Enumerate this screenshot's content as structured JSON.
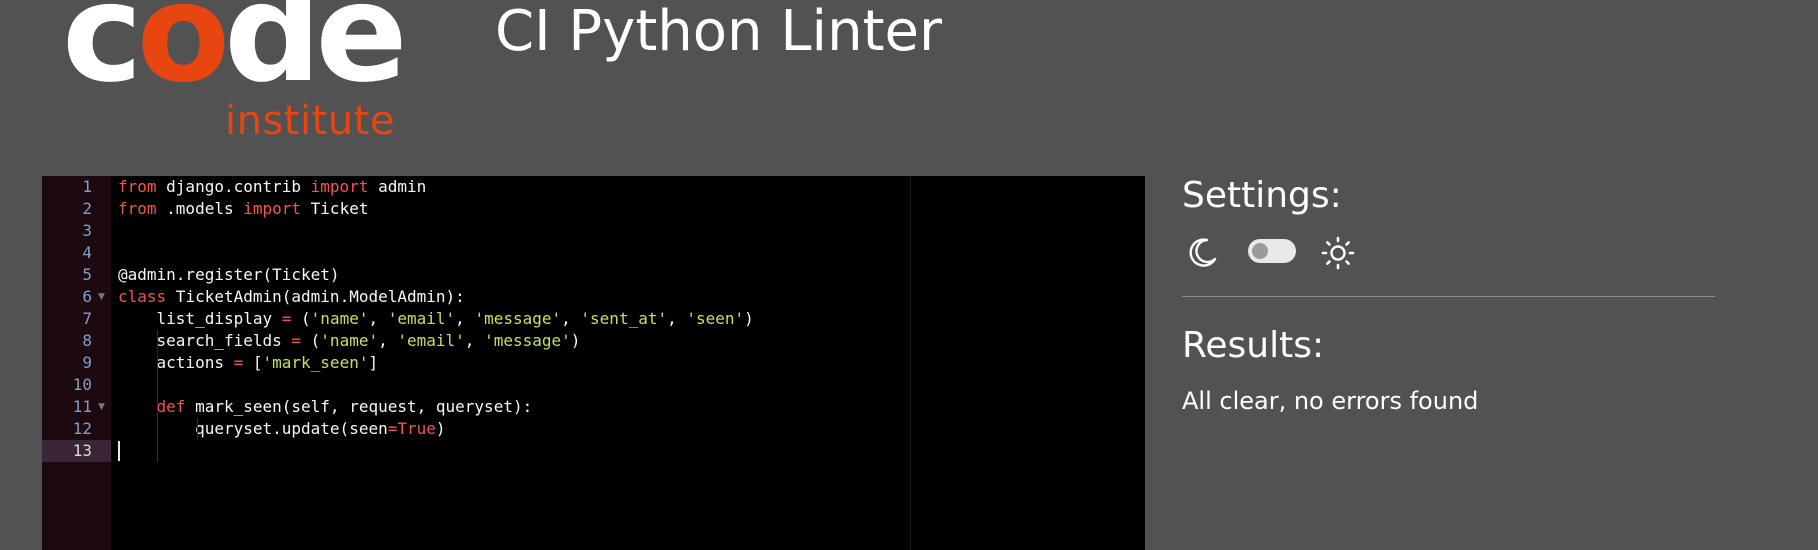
{
  "logo": {
    "word": "code",
    "word_parts": [
      "c",
      "o",
      "de"
    ],
    "subword": "institute"
  },
  "app_title": "CI Python Linter",
  "colors": {
    "background": "#525252",
    "brand_orange": "#e84610",
    "keyword": "#f9514c",
    "string": "#c6e05a",
    "editor_bg": "#000000"
  },
  "editor": {
    "active_line": 13,
    "line_numbers": [
      "1",
      "2",
      "3",
      "4",
      "5",
      "6",
      "7",
      "8",
      "9",
      "10",
      "11",
      "12",
      "13"
    ],
    "fold_markers": [
      "▼",
      "▼"
    ],
    "lines": [
      [
        {
          "t": "from",
          "c": "kw"
        },
        {
          "t": " django.contrib ",
          "c": ""
        },
        {
          "t": "import",
          "c": "kw"
        },
        {
          "t": " admin",
          "c": ""
        }
      ],
      [
        {
          "t": "from",
          "c": "kw"
        },
        {
          "t": " .models ",
          "c": ""
        },
        {
          "t": "import",
          "c": "kw"
        },
        {
          "t": " Ticket",
          "c": ""
        }
      ],
      [],
      [],
      [
        {
          "t": "@admin.register(Ticket)",
          "c": ""
        }
      ],
      [
        {
          "t": "class",
          "c": "kw"
        },
        {
          "t": " TicketAdmin(admin.ModelAdmin):",
          "c": ""
        }
      ],
      [
        {
          "t": "    list_display ",
          "c": ""
        },
        {
          "t": "=",
          "c": "op"
        },
        {
          "t": " (",
          "c": ""
        },
        {
          "t": "'name'",
          "c": "str"
        },
        {
          "t": ", ",
          "c": ""
        },
        {
          "t": "'email'",
          "c": "str"
        },
        {
          "t": ", ",
          "c": ""
        },
        {
          "t": "'message'",
          "c": "str"
        },
        {
          "t": ", ",
          "c": ""
        },
        {
          "t": "'sent_at'",
          "c": "str"
        },
        {
          "t": ", ",
          "c": ""
        },
        {
          "t": "'seen'",
          "c": "str"
        },
        {
          "t": ")",
          "c": ""
        }
      ],
      [
        {
          "t": "    search_fields ",
          "c": ""
        },
        {
          "t": "=",
          "c": "op"
        },
        {
          "t": " (",
          "c": ""
        },
        {
          "t": "'name'",
          "c": "str"
        },
        {
          "t": ", ",
          "c": ""
        },
        {
          "t": "'email'",
          "c": "str"
        },
        {
          "t": ", ",
          "c": ""
        },
        {
          "t": "'message'",
          "c": "str"
        },
        {
          "t": ")",
          "c": ""
        }
      ],
      [
        {
          "t": "    actions ",
          "c": ""
        },
        {
          "t": "=",
          "c": "op"
        },
        {
          "t": " [",
          "c": ""
        },
        {
          "t": "'mark_seen'",
          "c": "str"
        },
        {
          "t": "]",
          "c": ""
        }
      ],
      [],
      [
        {
          "t": "    ",
          "c": ""
        },
        {
          "t": "def",
          "c": "kw"
        },
        {
          "t": " mark_seen(self, request, queryset):",
          "c": ""
        }
      ],
      [
        {
          "t": "        queryset.update(seen",
          "c": ""
        },
        {
          "t": "=",
          "c": "op"
        },
        {
          "t": "True",
          "c": "cst"
        },
        {
          "t": ")",
          "c": ""
        }
      ],
      []
    ]
  },
  "settings": {
    "title": "Settings:",
    "dark_icon": "moon-icon",
    "light_icon": "sun-icon",
    "theme_toggle": "off"
  },
  "results": {
    "title": "Results:",
    "message": "All clear, no errors found"
  }
}
